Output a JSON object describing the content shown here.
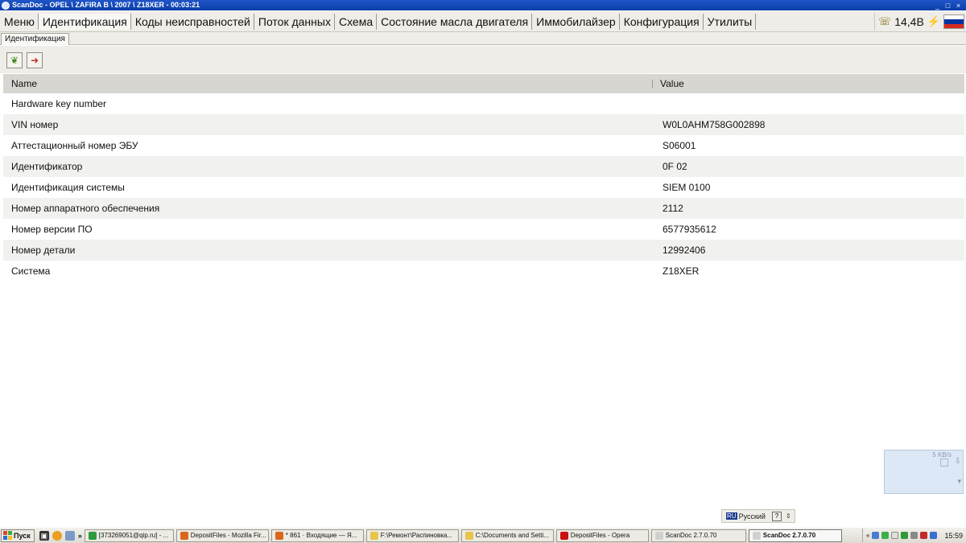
{
  "window": {
    "title": "ScanDoc - OPEL \\ ZAFIRA B \\ 2007 \\ Z18XER - 00:03:21",
    "buttons": [
      "_",
      "□",
      "×"
    ]
  },
  "menu": {
    "items": [
      {
        "label": "Меню"
      },
      {
        "label": "Идентификация",
        "active": true
      },
      {
        "label": "Коды неисправностей"
      },
      {
        "label": "Поток данных"
      },
      {
        "label": "Схема"
      },
      {
        "label": "Состояние масла двигателя"
      },
      {
        "label": "Иммобилайзер"
      },
      {
        "label": "Конфигурация"
      },
      {
        "label": "Утилиты"
      }
    ],
    "status": {
      "phone_icon": "phone-icon",
      "voltage": "14,4В",
      "plug_icon": "plug-icon",
      "flag_colors": [
        "#ffffff",
        "#0033a0",
        "#d52b1e"
      ]
    }
  },
  "subtab": {
    "label": "Идентификация"
  },
  "toolbar": {
    "buttons": [
      {
        "icon": "leaf-icon",
        "color": "#3d8a1f"
      },
      {
        "icon": "export-arrow-icon",
        "color": "#c0331b"
      }
    ]
  },
  "grid": {
    "columns": {
      "name": "Name",
      "value": "Value"
    },
    "rows": [
      {
        "name": "Hardware key number",
        "value": ""
      },
      {
        "name": "VIN номер",
        "value": "W0L0AHM758G002898"
      },
      {
        "name": "Аттестационный номер ЭБУ",
        "value": "S06001"
      },
      {
        "name": "Идентификатор",
        "value": "0F 02"
      },
      {
        "name": "Идентификация системы",
        "value": "SIEM 0100"
      },
      {
        "name": "Номер аппаратного обеспечения",
        "value": "2112"
      },
      {
        "name": "Номер версии ПО",
        "value": "6577935612"
      },
      {
        "name": "Номер детали",
        "value": "12992406"
      },
      {
        "name": "Система",
        "value": "Z18XER"
      }
    ]
  },
  "net_widget": {
    "rate": "5 KB/s"
  },
  "language_bar": {
    "code": "RU",
    "name": "Русский",
    "help": "?"
  },
  "taskbar": {
    "start_label": "Пуск",
    "quick_launch_more": "»",
    "tasks": [
      {
        "label": "[373269051@qip.ru] - ...",
        "icon_color": "#2e9a3a",
        "width": 111
      },
      {
        "label": "DepositFiles - Mozilla Fir...",
        "icon_color": "#d9681c",
        "width": 115
      },
      {
        "label": "* 861 · Входящие — Я...",
        "icon_color": "#d9681c",
        "width": 115
      },
      {
        "label": "F:\\Ремонт\\Распиновка...",
        "icon_color": "#e8c44a",
        "width": 115
      },
      {
        "label": "C:\\Documents and Setti...",
        "icon_color": "#e8c44a",
        "width": 115
      },
      {
        "label": "DepositFiles - Opera",
        "icon_color": "#cc1111",
        "width": 115
      },
      {
        "label": "ScanDoc 2.7.0.70",
        "icon_color": "#d0d0d0",
        "width": 118
      },
      {
        "label": "ScanDoc 2.7.0.70",
        "icon_color": "#d0d0d0",
        "width": 116,
        "active": true
      }
    ],
    "tray_more": "«",
    "clock": "15:59"
  }
}
